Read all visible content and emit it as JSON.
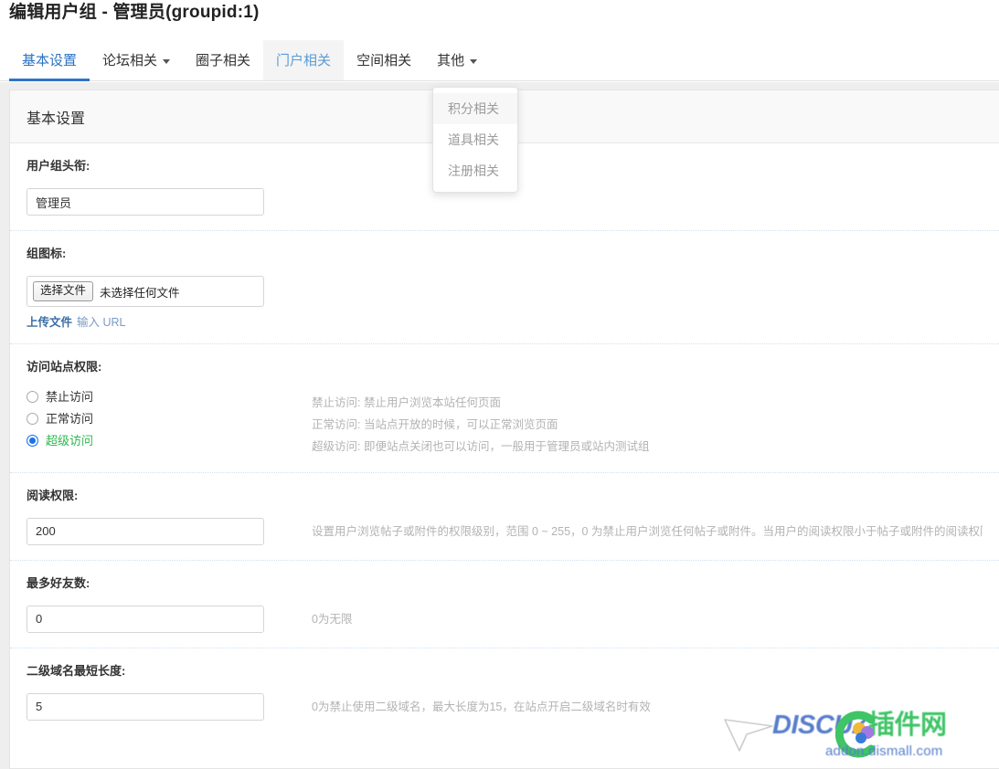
{
  "page": {
    "title": "编辑用户组 - 管理员(groupid:1)"
  },
  "tabs": [
    {
      "label": "基本设置",
      "state": "active",
      "has_caret": false
    },
    {
      "label": "论坛相关",
      "state": "normal",
      "has_caret": true
    },
    {
      "label": "圈子相关",
      "state": "normal",
      "has_caret": false
    },
    {
      "label": "门户相关",
      "state": "hover",
      "has_caret": false
    },
    {
      "label": "空间相关",
      "state": "normal",
      "has_caret": false
    },
    {
      "label": "其他",
      "state": "normal",
      "has_caret": true
    }
  ],
  "dropdown": {
    "open": true,
    "items": [
      {
        "label": "积分相关",
        "highlighted": true
      },
      {
        "label": "道具相关",
        "highlighted": false
      },
      {
        "label": "注册相关",
        "highlighted": false
      }
    ]
  },
  "panel": {
    "heading": "基本设置"
  },
  "form": {
    "group_title": {
      "label": "用户组头衔:",
      "value": "管理员"
    },
    "group_icon": {
      "label": "组图标:",
      "file_button": "选择文件",
      "file_status": "未选择任何文件",
      "link_upload": "上传文件",
      "link_url": "输入 URL"
    },
    "site_access": {
      "label": "访问站点权限:",
      "options": [
        {
          "label": "禁止访问",
          "checked": false,
          "green": false
        },
        {
          "label": "正常访问",
          "checked": false,
          "green": false
        },
        {
          "label": "超级访问",
          "checked": true,
          "green": true
        }
      ],
      "desc": [
        "禁止访问: 禁止用户浏览本站任何页面",
        "正常访问: 当站点开放的时候，可以正常浏览页面",
        "超级访问: 即便站点关闭也可以访问，一般用于管理员或站内测试组"
      ]
    },
    "read_access": {
      "label": "阅读权限:",
      "value": "200",
      "desc": "设置用户浏览帖子或附件的权限级别，范围 0 ~ 255，0 为禁止用户浏览任何帖子或附件。当用户的阅读权限小于帖子或附件的阅读权限许可(默认值)时，将无法查看"
    },
    "max_friends": {
      "label": "最多好友数:",
      "value": "0",
      "desc": "0为无限"
    },
    "domain_min_length": {
      "label": "二级域名最短长度:",
      "value": "5",
      "desc": "0为禁止使用二级域名，最大长度为15，在站点开启二级域名时有效"
    }
  },
  "watermark": {
    "brand_prefix": "DISCUZ",
    "brand_suffix": "插件网",
    "url": "addon.dismall.com"
  },
  "colors": {
    "accent_blue": "#2d74c9",
    "link_blue": "#3a6ea5",
    "green": "#2db84d",
    "panel_bg": "#ffffff",
    "content_bg": "#eeeeee"
  }
}
